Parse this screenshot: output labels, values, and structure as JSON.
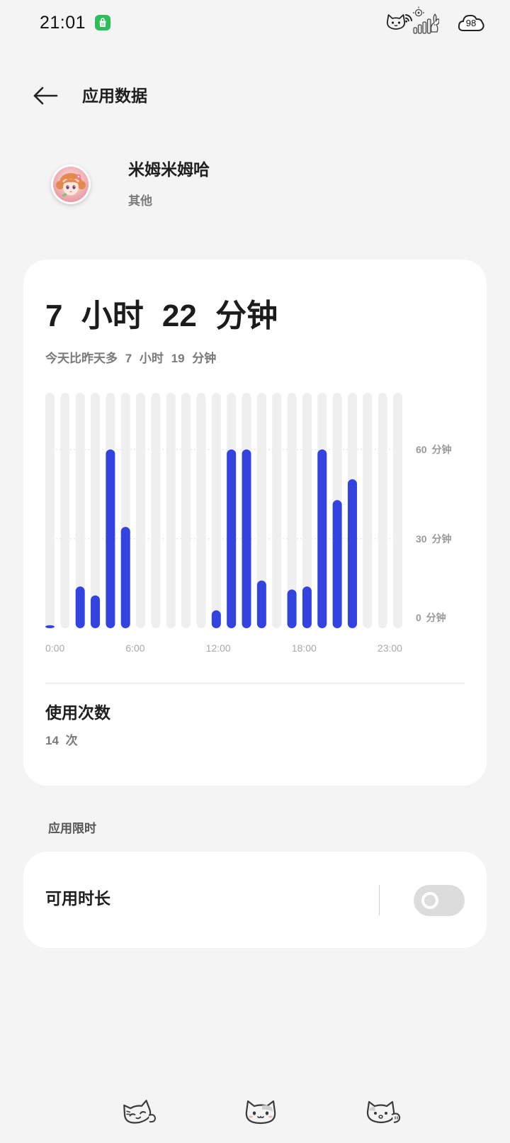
{
  "status_bar": {
    "time": "21:01",
    "battery": "98",
    "icons": {
      "notification": "shopping-bag-icon",
      "wifi": "cat-wifi-icon",
      "signal": "cat-signal-icon",
      "battery": "cloud-battery-icon"
    }
  },
  "header": {
    "back_icon": "back-arrow-icon",
    "title": "应用数据"
  },
  "app": {
    "icon": "app-avatar-icon",
    "name": "米姆米姆哈",
    "category": "其他"
  },
  "usage": {
    "total": "7 小时 22 分钟",
    "comparison": "今天比昨天多 7 小时 19 分钟"
  },
  "chart_data": {
    "type": "bar",
    "x": [
      0,
      1,
      2,
      3,
      4,
      5,
      6,
      7,
      8,
      9,
      10,
      11,
      12,
      13,
      14,
      15,
      16,
      17,
      18,
      19,
      20,
      21,
      22,
      23
    ],
    "values": [
      1,
      0,
      14,
      11,
      60,
      34,
      0,
      0,
      0,
      0,
      0,
      6,
      60,
      60,
      16,
      0,
      13,
      14,
      60,
      43,
      50,
      0,
      0,
      0
    ],
    "x_tick_labels": [
      "0:00",
      "6:00",
      "12:00",
      "18:00",
      "23:00"
    ],
    "y_ticks": [
      60,
      30,
      0
    ],
    "y_tick_labels": [
      "60 分钟",
      "30 分钟",
      "0 分钟"
    ],
    "ylim": [
      0,
      79
    ],
    "grid": true,
    "legend": "none",
    "bar_color": "#3243e0",
    "track_color": "#efefef"
  },
  "launches": {
    "label": "使用次数",
    "value": "14 次"
  },
  "app_limit": {
    "section_title": "应用限时",
    "item_label": "可用时长",
    "toggle_on": false
  },
  "nav_bar": {
    "icons": [
      "recents-cat-icon",
      "home-cat-icon",
      "back-cat-icon"
    ]
  },
  "colors": {
    "background": "#f4f4f4",
    "card": "#ffffff",
    "accent": "#3243e0",
    "toggle_off": "#dcdcdc",
    "notification_green": "#2dbd5a"
  }
}
